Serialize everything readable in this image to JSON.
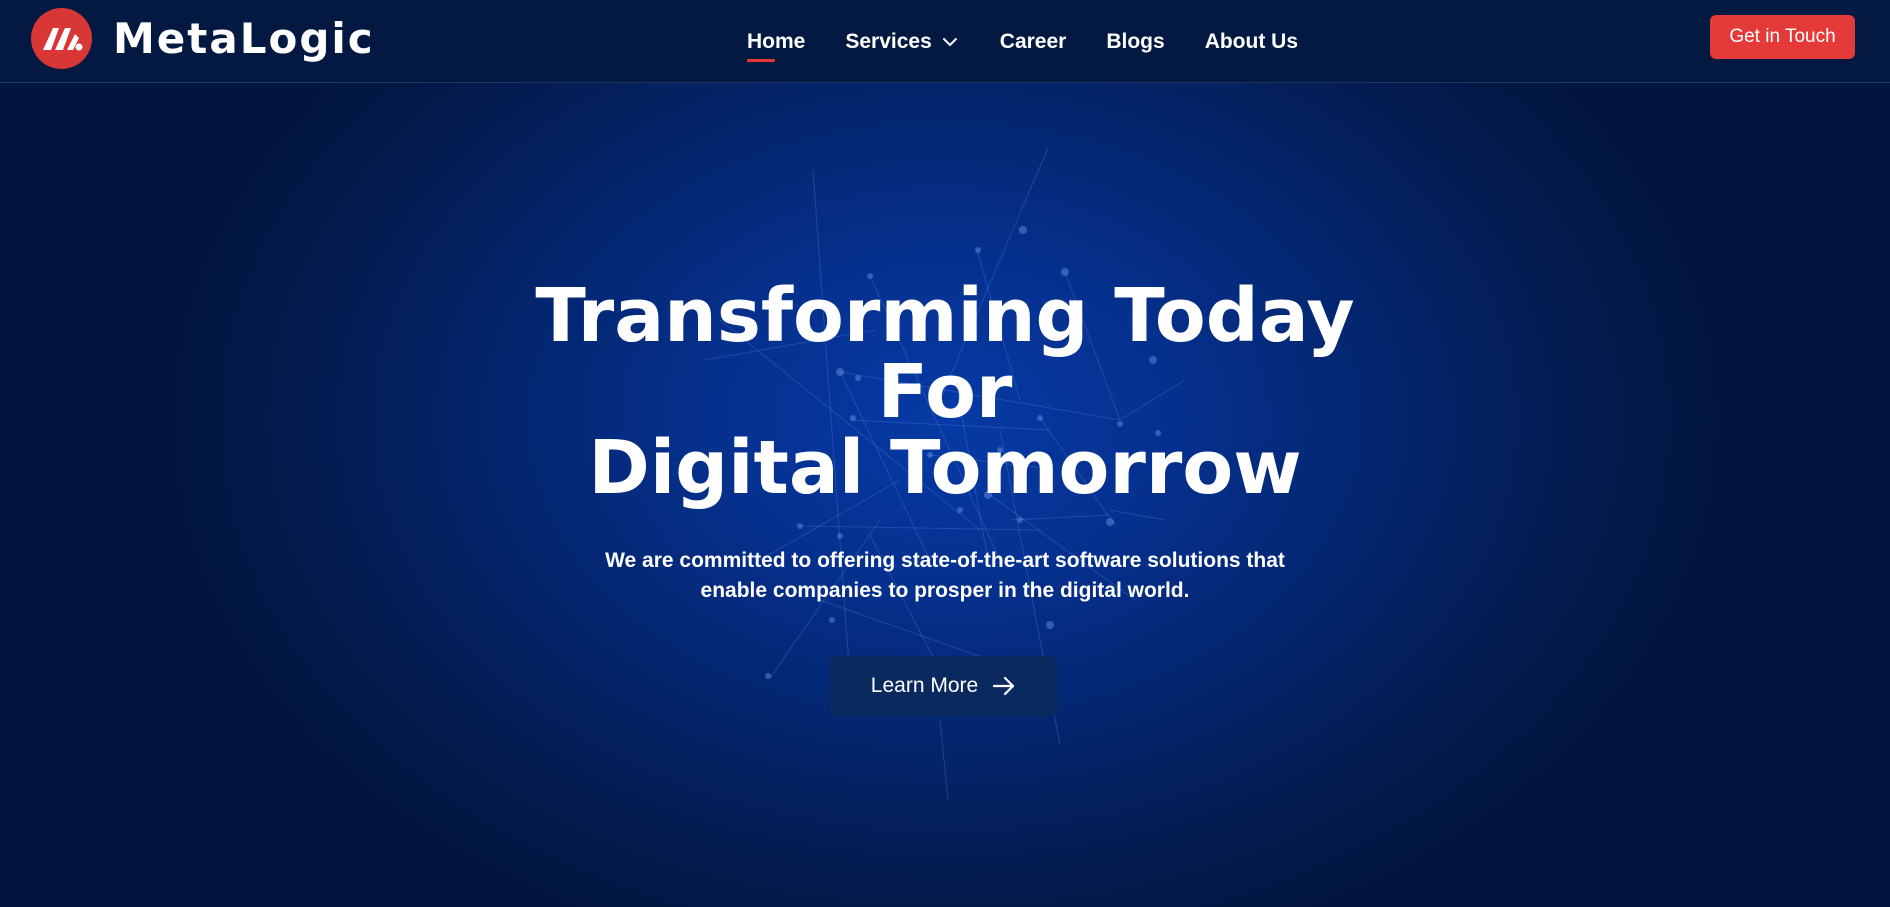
{
  "brand": {
    "name": "MetaLogic",
    "accent": "#e53a3a",
    "background": "#031941"
  },
  "nav": {
    "items": [
      {
        "label": "Home",
        "active": true
      },
      {
        "label": "Services",
        "has_dropdown": true,
        "icon": "chevron-down-icon"
      },
      {
        "label": "Career"
      },
      {
        "label": "Blogs"
      },
      {
        "label": "About Us"
      }
    ],
    "cta_label": "Get in Touch"
  },
  "hero": {
    "title_lines": [
      "Transforming Today",
      "For",
      "Digital Tomorrow"
    ],
    "subtitle_lines": [
      "We are committed to offering state-of-the-art software solutions that",
      "enable companies to prosper in the digital world."
    ],
    "button_label": "Learn More",
    "button_icon": "arrow-right-icon"
  }
}
